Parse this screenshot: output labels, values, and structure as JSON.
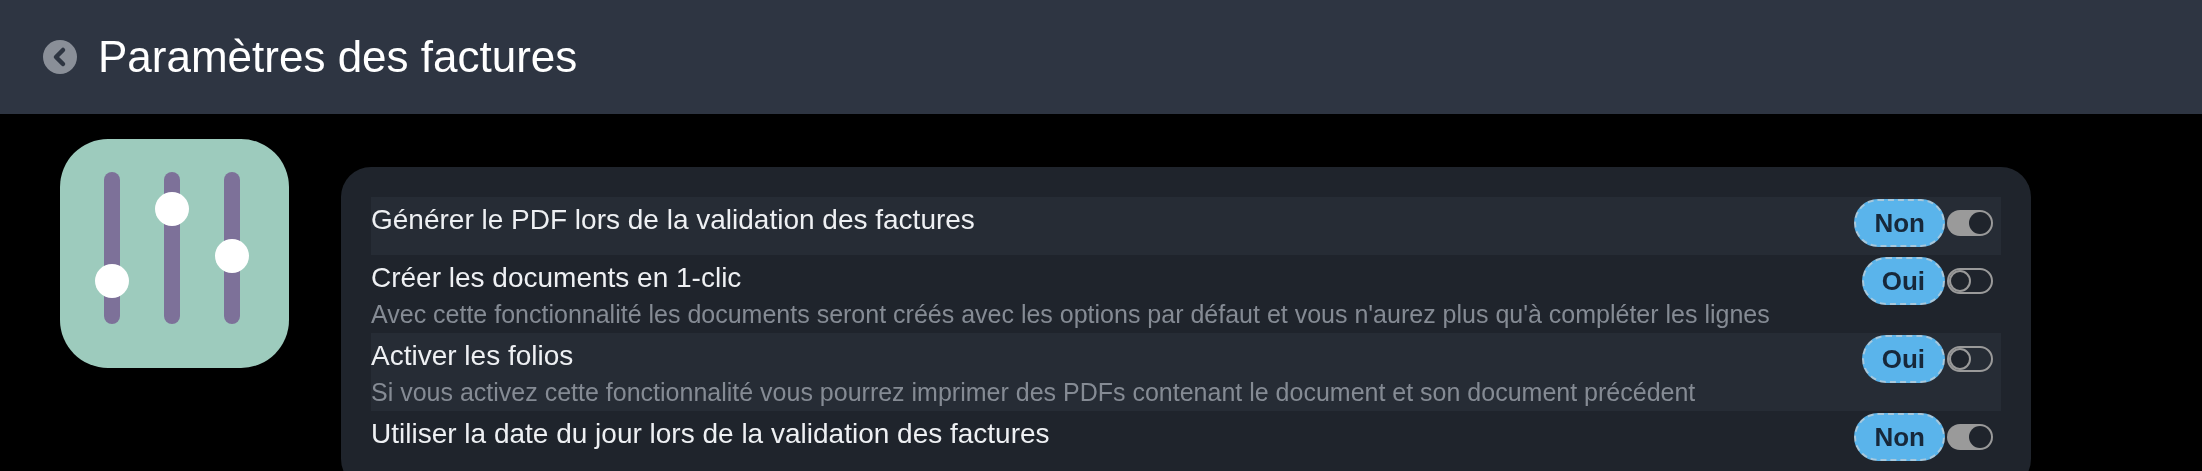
{
  "header": {
    "title": "Paramètres des factures"
  },
  "settings": [
    {
      "label": "Générer le PDF lors de la validation des factures",
      "value": "Non",
      "on": true
    },
    {
      "label": "Créer les documents en 1-clic",
      "description": "Avec cette fonctionnalité les documents seront créés avec les options par défaut et vous n'aurez plus qu'à compléter les lignes",
      "value": "Oui",
      "on": false
    },
    {
      "label": "Activer les folios",
      "description": "Si vous activez cette fonctionnalité vous pourrez imprimer des PDFs contenant le document et son document précédent",
      "value": "Oui",
      "on": false
    },
    {
      "label": "Utiliser la date du jour lors de la validation des factures",
      "value": "Non",
      "on": true
    }
  ]
}
